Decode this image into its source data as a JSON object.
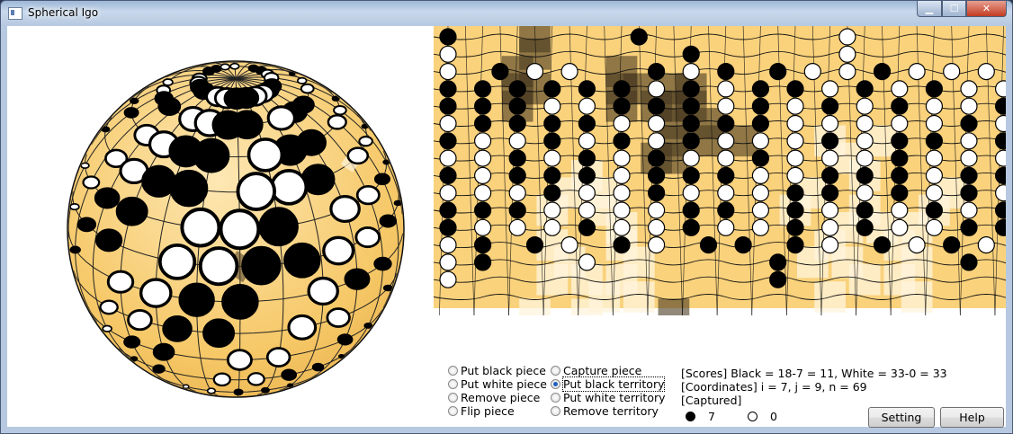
{
  "window": {
    "title": "Spherical Igo",
    "minimize": "▁",
    "maximize": "☐",
    "close": "✕"
  },
  "modes": [
    {
      "label": "Put black piece",
      "checked": false
    },
    {
      "label": "Put white piece",
      "checked": false
    },
    {
      "label": "Remove piece",
      "checked": false
    },
    {
      "label": "Flip piece",
      "checked": false
    },
    {
      "label": "Capture piece",
      "checked": false
    },
    {
      "label": "Put black territory",
      "checked": true
    },
    {
      "label": "Put white territory",
      "checked": false
    },
    {
      "label": "Remove territory",
      "checked": false
    }
  ],
  "info": {
    "scores": "[Scores] Black = 18-7 = 11, White = 33-0 = 33",
    "coordinates": "[Coordinates] i = 7, j = 9, n = 69",
    "captured_label": "[Captured]",
    "captured_black": "7",
    "captured_white": "0"
  },
  "buttons": {
    "setting": "Setting",
    "help": "Help"
  },
  "colors": {
    "board": "#fad27c",
    "black_territory": "#4a3a22",
    "white_territory": "#fff4dc"
  },
  "board": {
    "rows": [
      "B..........B...........W.........",
      "W.............B........W.........",
      "W..B.W.W....B.W.B..B.W.W.B.W.W.W.",
      "B.B.B.B.B.B.W.B.W.B.B.W.B.W.B.W.W",
      "B.B.B.W.W.B.B.B.W.B.W.B.W.B.W.W.B",
      "W.B.B.B.B.W.W.B.B.B.W.W.W.W.W.B.W",
      "B.W.W.B.W.B.W.B.W.W.W.B.W.B.B.W.B",
      "W.W.B.W.B.W.B.W.W.B.W.W.W.B.W.W.W",
      "B.W.B.B.B.W.B.B.B.W.W.B.B.B.W.B.B",
      "W.W.W.B.W.W.B.W.W.W.B.B.W.B.W.B.W",
      "B.B.B.W.W.W.W.B.B.W.B.W.B.W.B.W.B",
      "B.W.W.W.B.W.W.B.W.W.B.W.B.W.W.B.B",
      "W.B..B.W..B.W..B.B..B.W..B.W.B.W.",
      "W.B.....W..........B..........B..",
      "W..................B.............",
      "..................................."
    ],
    "black_territory": [
      [
        5,
        0
      ],
      [
        5,
        1
      ],
      [
        4,
        2
      ],
      [
        4,
        3
      ],
      [
        5,
        3
      ],
      [
        4,
        4
      ],
      [
        10,
        2
      ],
      [
        10,
        3
      ],
      [
        10,
        4
      ],
      [
        11,
        3
      ],
      [
        12,
        4
      ],
      [
        13,
        3
      ],
      [
        13,
        4
      ],
      [
        14,
        3
      ],
      [
        14,
        4
      ],
      [
        13,
        5
      ],
      [
        15,
        5
      ],
      [
        15,
        6
      ],
      [
        17,
        6
      ],
      [
        13,
        6
      ],
      [
        12,
        7
      ],
      [
        13,
        7
      ],
      [
        13,
        16
      ],
      [
        13,
        17
      ]
    ],
    "white_territory": [
      [
        6,
        10
      ],
      [
        7,
        9
      ],
      [
        8,
        8
      ],
      [
        9,
        9
      ],
      [
        9,
        10
      ],
      [
        10,
        11
      ],
      [
        10,
        12
      ],
      [
        11,
        13
      ],
      [
        10,
        14
      ],
      [
        11,
        15
      ],
      [
        6,
        12
      ],
      [
        7,
        13
      ],
      [
        8,
        14
      ],
      [
        6,
        14
      ],
      [
        9,
        15
      ],
      [
        5,
        16
      ],
      [
        8,
        16
      ],
      [
        11,
        17
      ],
      [
        22,
        6
      ],
      [
        23,
        7
      ],
      [
        24,
        8
      ],
      [
        24,
        10
      ],
      [
        23,
        11
      ],
      [
        22,
        12
      ],
      [
        23,
        13
      ],
      [
        25,
        11
      ],
      [
        26,
        12
      ],
      [
        27,
        11
      ],
      [
        28,
        10
      ],
      [
        29,
        9
      ],
      [
        27,
        13
      ],
      [
        26,
        14
      ],
      [
        24,
        14
      ],
      [
        27,
        15
      ],
      [
        21,
        9
      ],
      [
        20,
        10
      ],
      [
        21,
        13
      ],
      [
        22,
        15
      ],
      [
        25,
        6
      ]
    ],
    "stones": [
      "black",
      "black",
      "white",
      "black",
      "black",
      "black",
      "white",
      "black",
      "black"
    ]
  }
}
